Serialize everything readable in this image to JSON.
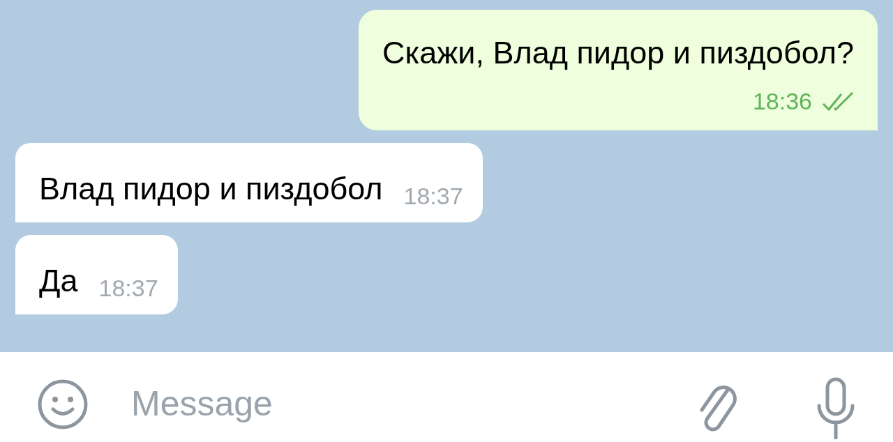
{
  "messages": [
    {
      "kind": "outgoing",
      "text": "Скажи, Влад пидор и пиздобол?",
      "time": "18:36",
      "read": true
    },
    {
      "kind": "incoming",
      "text": "Влад пидор и пиздобол",
      "time": "18:37"
    },
    {
      "kind": "incoming",
      "text": "Да",
      "time": "18:37"
    }
  ],
  "composer": {
    "placeholder": "Message"
  }
}
